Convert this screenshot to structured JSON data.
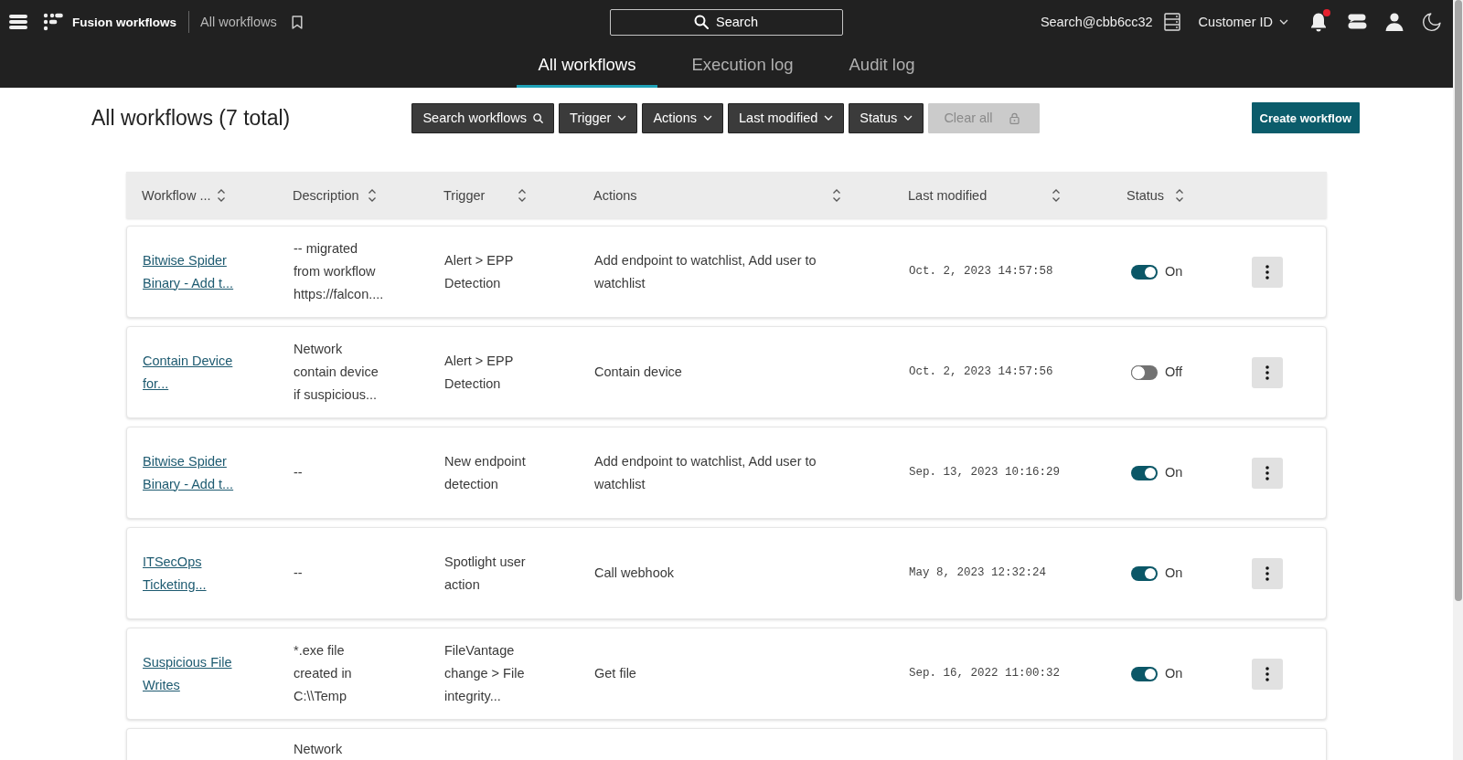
{
  "top_bar": {
    "app_name": "Fusion workflows",
    "breadcrumb": "All workflows",
    "search": {
      "placeholder": "Search"
    },
    "account": "Search@cbb6cc32",
    "customer_menu": "Customer ID",
    "unread_notifications": true
  },
  "tabs": [
    {
      "label": "All workflows",
      "selected": true
    },
    {
      "label": "Execution log",
      "selected": false
    },
    {
      "label": "Audit log",
      "selected": false
    }
  ],
  "page": {
    "title": "All workflows (7 total)",
    "filters": [
      {
        "label": "Search workflows",
        "kind": "search",
        "disabled": false
      },
      {
        "label": "Trigger",
        "kind": "dropdown",
        "disabled": false
      },
      {
        "label": "Actions",
        "kind": "dropdown",
        "disabled": false
      },
      {
        "label": "Last modified",
        "kind": "dropdown",
        "disabled": false
      },
      {
        "label": "Status",
        "kind": "dropdown",
        "disabled": false
      },
      {
        "label": "Clear all",
        "kind": "clear",
        "disabled": true
      }
    ],
    "create_button": "Create workflow"
  },
  "table": {
    "columns": [
      "Workflow ...",
      "Description",
      "Trigger",
      "Actions",
      "Last modified",
      "Status"
    ],
    "rows": [
      {
        "name": "Bitwise Spider Binary - Add t...",
        "description": "-- migrated from workflow https://falcon....",
        "trigger": "Alert > EPP Detection",
        "actions": "Add endpoint to watchlist, Add user to watchlist",
        "last_modified": "Oct. 2, 2023 14:57:58",
        "status": {
          "on": true,
          "label": "On"
        }
      },
      {
        "name": "Contain Device for...",
        "description": "Network contain device if suspicious...",
        "trigger": "Alert > EPP Detection",
        "actions": "Contain device",
        "last_modified": "Oct. 2, 2023 14:57:56",
        "status": {
          "on": false,
          "label": "Off"
        }
      },
      {
        "name": "Bitwise Spider Binary - Add t...",
        "description": "--",
        "trigger": "New endpoint detection",
        "actions": "Add endpoint to watchlist, Add user to watchlist",
        "last_modified": "Sep. 13, 2023 10:16:29",
        "status": {
          "on": true,
          "label": "On"
        }
      },
      {
        "name": "ITSecOps Ticketing...",
        "description": "--",
        "trigger": "Spotlight user action",
        "actions": "Call webhook",
        "last_modified": "May 8, 2023 12:32:24",
        "status": {
          "on": true,
          "label": "On"
        }
      },
      {
        "name": "Suspicious File Writes",
        "description": "*.exe file created in C:\\\\Temp",
        "trigger": "FileVantage change > File integrity...",
        "actions": "Get file",
        "last_modified": "Sep. 16, 2022 11:00:32",
        "status": {
          "on": true,
          "label": "On"
        }
      },
      {
        "description": "Network"
      }
    ]
  }
}
